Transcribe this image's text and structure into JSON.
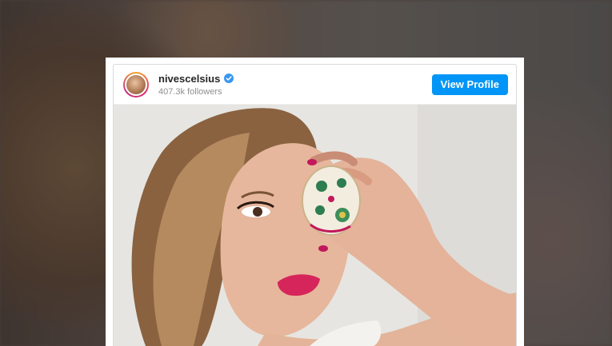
{
  "embed": {
    "username": "nivescelsius",
    "followers": "407.3k followers",
    "view_profile_label": "View Profile",
    "verified": true
  },
  "icons": {
    "verified": "verified-badge-icon"
  },
  "colors": {
    "accent": "#0095f6",
    "username": "#262626",
    "secondary_text": "#8e8e8e",
    "verified": "#3897f0"
  }
}
